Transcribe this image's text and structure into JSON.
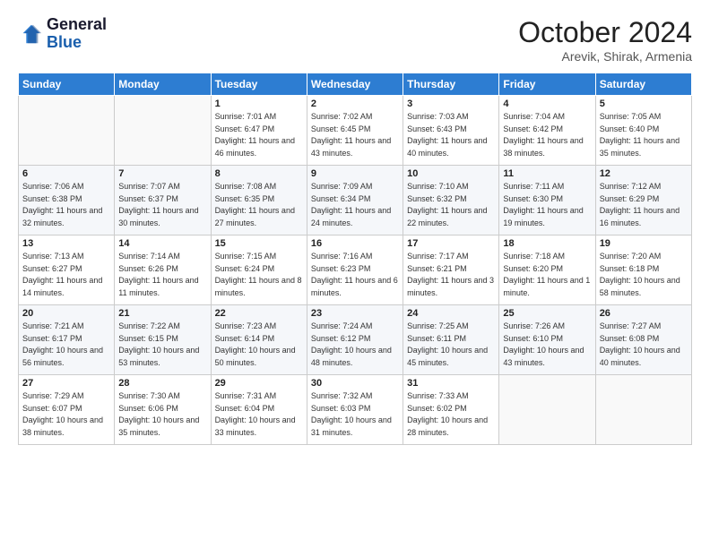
{
  "header": {
    "logo_line1": "General",
    "logo_line2": "Blue",
    "title": "October 2024",
    "location": "Arevik, Shirak, Armenia"
  },
  "days_of_week": [
    "Sunday",
    "Monday",
    "Tuesday",
    "Wednesday",
    "Thursday",
    "Friday",
    "Saturday"
  ],
  "weeks": [
    [
      {
        "day": "",
        "sunrise": "",
        "sunset": "",
        "daylight": ""
      },
      {
        "day": "",
        "sunrise": "",
        "sunset": "",
        "daylight": ""
      },
      {
        "day": "1",
        "sunrise": "Sunrise: 7:01 AM",
        "sunset": "Sunset: 6:47 PM",
        "daylight": "Daylight: 11 hours and 46 minutes."
      },
      {
        "day": "2",
        "sunrise": "Sunrise: 7:02 AM",
        "sunset": "Sunset: 6:45 PM",
        "daylight": "Daylight: 11 hours and 43 minutes."
      },
      {
        "day": "3",
        "sunrise": "Sunrise: 7:03 AM",
        "sunset": "Sunset: 6:43 PM",
        "daylight": "Daylight: 11 hours and 40 minutes."
      },
      {
        "day": "4",
        "sunrise": "Sunrise: 7:04 AM",
        "sunset": "Sunset: 6:42 PM",
        "daylight": "Daylight: 11 hours and 38 minutes."
      },
      {
        "day": "5",
        "sunrise": "Sunrise: 7:05 AM",
        "sunset": "Sunset: 6:40 PM",
        "daylight": "Daylight: 11 hours and 35 minutes."
      }
    ],
    [
      {
        "day": "6",
        "sunrise": "Sunrise: 7:06 AM",
        "sunset": "Sunset: 6:38 PM",
        "daylight": "Daylight: 11 hours and 32 minutes."
      },
      {
        "day": "7",
        "sunrise": "Sunrise: 7:07 AM",
        "sunset": "Sunset: 6:37 PM",
        "daylight": "Daylight: 11 hours and 30 minutes."
      },
      {
        "day": "8",
        "sunrise": "Sunrise: 7:08 AM",
        "sunset": "Sunset: 6:35 PM",
        "daylight": "Daylight: 11 hours and 27 minutes."
      },
      {
        "day": "9",
        "sunrise": "Sunrise: 7:09 AM",
        "sunset": "Sunset: 6:34 PM",
        "daylight": "Daylight: 11 hours and 24 minutes."
      },
      {
        "day": "10",
        "sunrise": "Sunrise: 7:10 AM",
        "sunset": "Sunset: 6:32 PM",
        "daylight": "Daylight: 11 hours and 22 minutes."
      },
      {
        "day": "11",
        "sunrise": "Sunrise: 7:11 AM",
        "sunset": "Sunset: 6:30 PM",
        "daylight": "Daylight: 11 hours and 19 minutes."
      },
      {
        "day": "12",
        "sunrise": "Sunrise: 7:12 AM",
        "sunset": "Sunset: 6:29 PM",
        "daylight": "Daylight: 11 hours and 16 minutes."
      }
    ],
    [
      {
        "day": "13",
        "sunrise": "Sunrise: 7:13 AM",
        "sunset": "Sunset: 6:27 PM",
        "daylight": "Daylight: 11 hours and 14 minutes."
      },
      {
        "day": "14",
        "sunrise": "Sunrise: 7:14 AM",
        "sunset": "Sunset: 6:26 PM",
        "daylight": "Daylight: 11 hours and 11 minutes."
      },
      {
        "day": "15",
        "sunrise": "Sunrise: 7:15 AM",
        "sunset": "Sunset: 6:24 PM",
        "daylight": "Daylight: 11 hours and 8 minutes."
      },
      {
        "day": "16",
        "sunrise": "Sunrise: 7:16 AM",
        "sunset": "Sunset: 6:23 PM",
        "daylight": "Daylight: 11 hours and 6 minutes."
      },
      {
        "day": "17",
        "sunrise": "Sunrise: 7:17 AM",
        "sunset": "Sunset: 6:21 PM",
        "daylight": "Daylight: 11 hours and 3 minutes."
      },
      {
        "day": "18",
        "sunrise": "Sunrise: 7:18 AM",
        "sunset": "Sunset: 6:20 PM",
        "daylight": "Daylight: 11 hours and 1 minute."
      },
      {
        "day": "19",
        "sunrise": "Sunrise: 7:20 AM",
        "sunset": "Sunset: 6:18 PM",
        "daylight": "Daylight: 10 hours and 58 minutes."
      }
    ],
    [
      {
        "day": "20",
        "sunrise": "Sunrise: 7:21 AM",
        "sunset": "Sunset: 6:17 PM",
        "daylight": "Daylight: 10 hours and 56 minutes."
      },
      {
        "day": "21",
        "sunrise": "Sunrise: 7:22 AM",
        "sunset": "Sunset: 6:15 PM",
        "daylight": "Daylight: 10 hours and 53 minutes."
      },
      {
        "day": "22",
        "sunrise": "Sunrise: 7:23 AM",
        "sunset": "Sunset: 6:14 PM",
        "daylight": "Daylight: 10 hours and 50 minutes."
      },
      {
        "day": "23",
        "sunrise": "Sunrise: 7:24 AM",
        "sunset": "Sunset: 6:12 PM",
        "daylight": "Daylight: 10 hours and 48 minutes."
      },
      {
        "day": "24",
        "sunrise": "Sunrise: 7:25 AM",
        "sunset": "Sunset: 6:11 PM",
        "daylight": "Daylight: 10 hours and 45 minutes."
      },
      {
        "day": "25",
        "sunrise": "Sunrise: 7:26 AM",
        "sunset": "Sunset: 6:10 PM",
        "daylight": "Daylight: 10 hours and 43 minutes."
      },
      {
        "day": "26",
        "sunrise": "Sunrise: 7:27 AM",
        "sunset": "Sunset: 6:08 PM",
        "daylight": "Daylight: 10 hours and 40 minutes."
      }
    ],
    [
      {
        "day": "27",
        "sunrise": "Sunrise: 7:29 AM",
        "sunset": "Sunset: 6:07 PM",
        "daylight": "Daylight: 10 hours and 38 minutes."
      },
      {
        "day": "28",
        "sunrise": "Sunrise: 7:30 AM",
        "sunset": "Sunset: 6:06 PM",
        "daylight": "Daylight: 10 hours and 35 minutes."
      },
      {
        "day": "29",
        "sunrise": "Sunrise: 7:31 AM",
        "sunset": "Sunset: 6:04 PM",
        "daylight": "Daylight: 10 hours and 33 minutes."
      },
      {
        "day": "30",
        "sunrise": "Sunrise: 7:32 AM",
        "sunset": "Sunset: 6:03 PM",
        "daylight": "Daylight: 10 hours and 31 minutes."
      },
      {
        "day": "31",
        "sunrise": "Sunrise: 7:33 AM",
        "sunset": "Sunset: 6:02 PM",
        "daylight": "Daylight: 10 hours and 28 minutes."
      },
      {
        "day": "",
        "sunrise": "",
        "sunset": "",
        "daylight": ""
      },
      {
        "day": "",
        "sunrise": "",
        "sunset": "",
        "daylight": ""
      }
    ]
  ]
}
